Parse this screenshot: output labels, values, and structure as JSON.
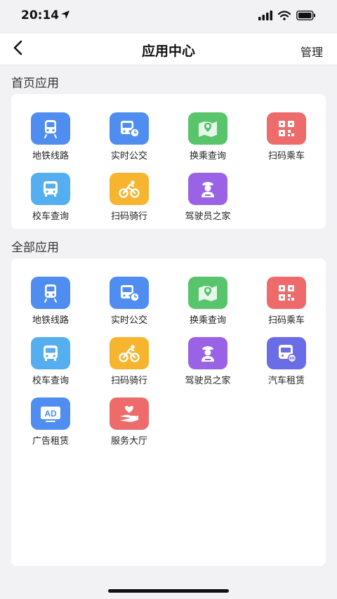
{
  "status_bar": {
    "time": "20:14"
  },
  "nav": {
    "title": "应用中心",
    "manage_label": "管理"
  },
  "sections": {
    "home_title": "首页应用",
    "all_title": "全部应用"
  },
  "home_apps": [
    {
      "label": "地铁线路",
      "icon": "subway-icon",
      "color": "#4f8df0"
    },
    {
      "label": "实时公交",
      "icon": "bus-clock-icon",
      "color": "#4f8df0"
    },
    {
      "label": "换乘查询",
      "icon": "map-pin-icon",
      "color": "#58c46b"
    },
    {
      "label": "扫码乘车",
      "icon": "qr-code-icon",
      "color": "#ee6b6b"
    },
    {
      "label": "校车查询",
      "icon": "school-bus-icon",
      "color": "#55aef0"
    },
    {
      "label": "扫码骑行",
      "icon": "cyclist-icon",
      "color": "#f7b52f"
    },
    {
      "label": "驾驶员之家",
      "icon": "driver-icon",
      "color": "#9a63e6"
    }
  ],
  "all_apps": [
    {
      "label": "地铁线路",
      "icon": "subway-icon",
      "color": "#4f8df0"
    },
    {
      "label": "实时公交",
      "icon": "bus-clock-icon",
      "color": "#4f8df0"
    },
    {
      "label": "换乘查询",
      "icon": "map-pin-icon",
      "color": "#58c46b"
    },
    {
      "label": "扫码乘车",
      "icon": "qr-code-icon",
      "color": "#ee6b6b"
    },
    {
      "label": "校车查询",
      "icon": "school-bus-icon",
      "color": "#55aef0"
    },
    {
      "label": "扫码骑行",
      "icon": "cyclist-icon",
      "color": "#f7b52f"
    },
    {
      "label": "驾驶员之家",
      "icon": "driver-icon",
      "color": "#9a63e6"
    },
    {
      "label": "汽车租赁",
      "icon": "car-rental-icon",
      "color": "#6b6de6"
    },
    {
      "label": "广告租赁",
      "icon": "ad-icon",
      "color": "#4f8df0"
    },
    {
      "label": "服务大厅",
      "icon": "service-hand-icon",
      "color": "#ee6b6b"
    }
  ],
  "ad_icon_text": "AD"
}
